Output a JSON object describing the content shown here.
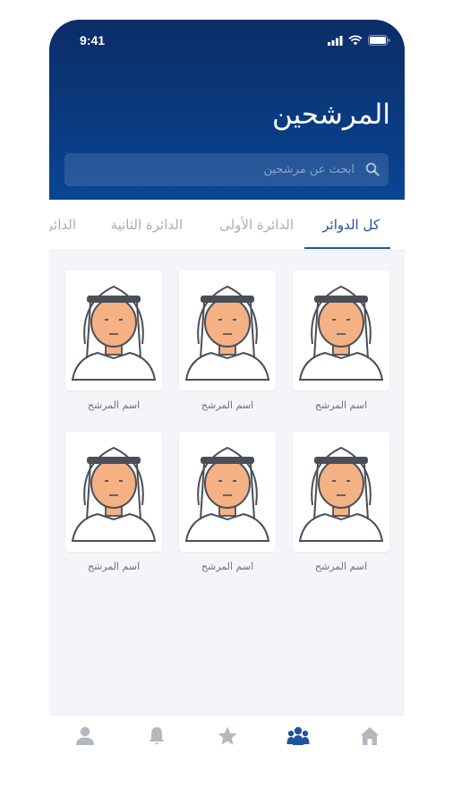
{
  "status_bar": {
    "time": "9:41"
  },
  "header": {
    "title": "المرشحين",
    "search_placeholder": "ابحث عن مرشحين"
  },
  "tabs": [
    {
      "label": "كل الدوائر",
      "active": true
    },
    {
      "label": "الدائرة الأولى",
      "active": false
    },
    {
      "label": "الدائرة الثانية",
      "active": false
    },
    {
      "label": "الدائرة الثالثة",
      "active": false
    }
  ],
  "candidates": [
    {
      "name": "اسم المرشح"
    },
    {
      "name": "اسم المرشح"
    },
    {
      "name": "اسم المرشح"
    },
    {
      "name": "اسم المرشح"
    },
    {
      "name": "اسم المرشح"
    },
    {
      "name": "اسم المرشح"
    }
  ],
  "bottom_nav": [
    {
      "icon": "home-icon",
      "active": false
    },
    {
      "icon": "candidates-icon",
      "active": true
    },
    {
      "icon": "star-icon",
      "active": false
    },
    {
      "icon": "bell-icon",
      "active": false
    },
    {
      "icon": "user-icon",
      "active": false
    }
  ],
  "colors": {
    "header_top": "#0b2d66",
    "header_bottom": "#0a4594",
    "accent": "#1e55a0",
    "inactive": "#a9aeb6",
    "skin": "#f3b184"
  }
}
